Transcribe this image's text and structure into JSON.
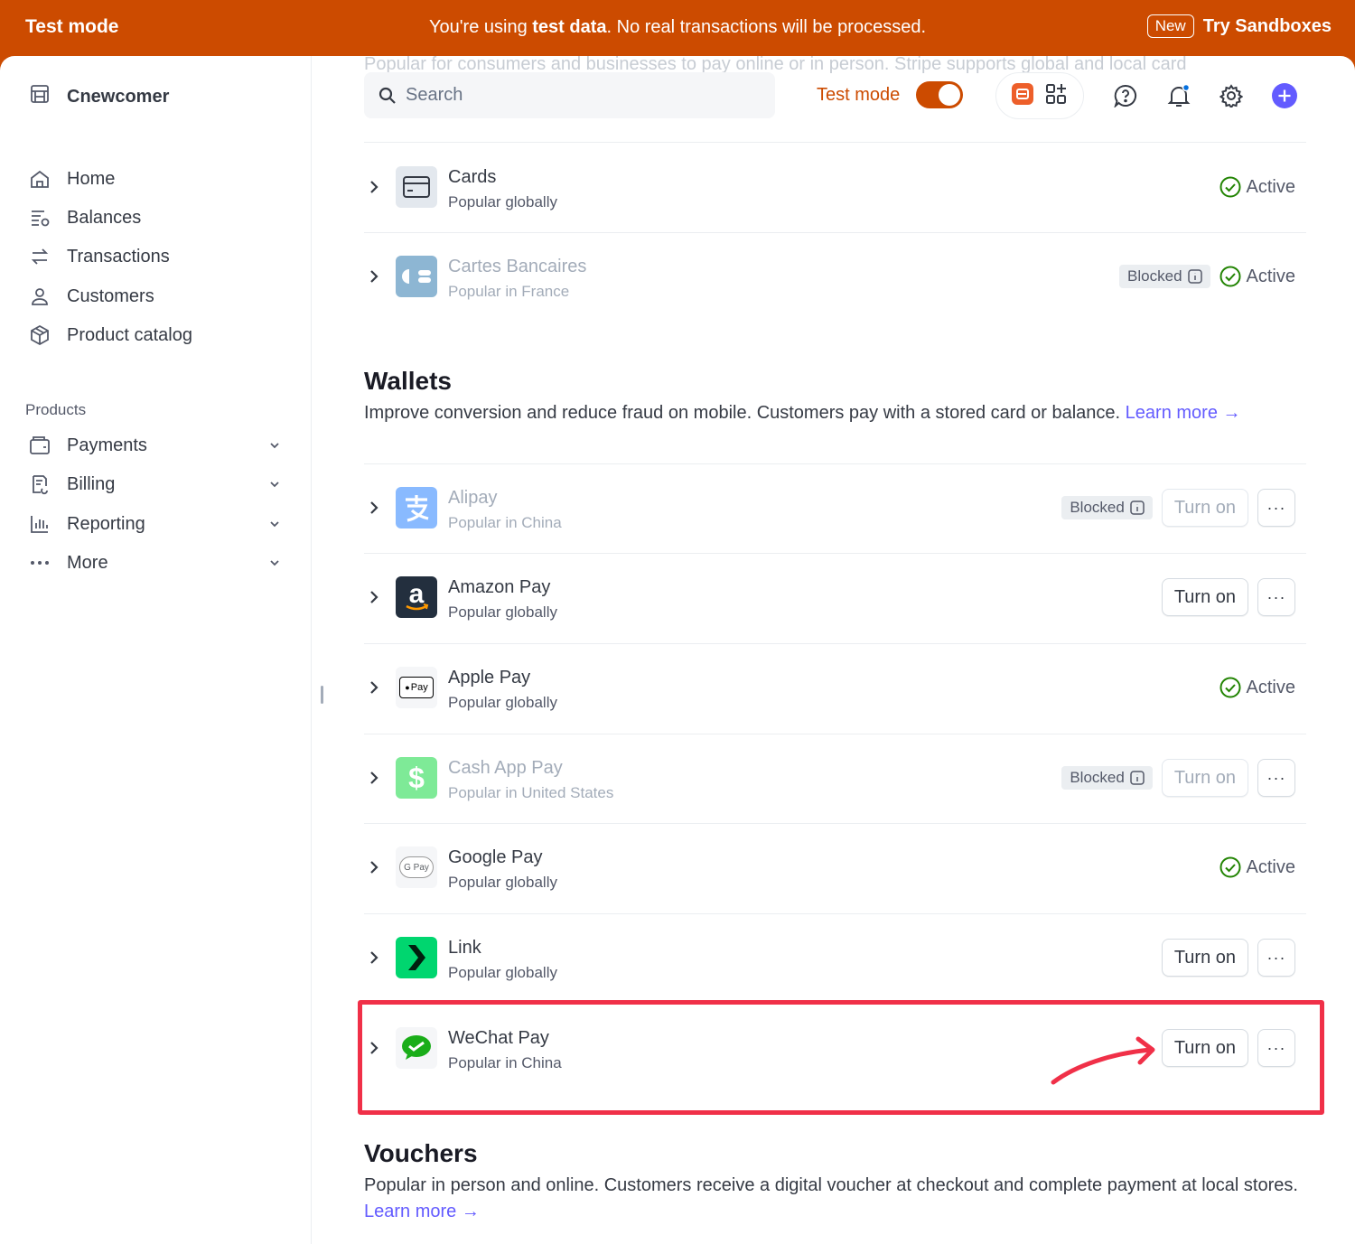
{
  "banner": {
    "label": "Test mode",
    "message_pre": "You're using ",
    "message_bold": "test data",
    "message_post": ". No real transactions will be processed.",
    "new_badge": "New",
    "sandboxes_link": "Try Sandboxes"
  },
  "sidebar": {
    "account": "Cnewcomer",
    "nav": [
      {
        "label": "Home",
        "icon": "home-icon"
      },
      {
        "label": "Balances",
        "icon": "balances-icon"
      },
      {
        "label": "Transactions",
        "icon": "transactions-icon"
      },
      {
        "label": "Customers",
        "icon": "customers-icon"
      },
      {
        "label": "Product catalog",
        "icon": "product-catalog-icon"
      }
    ],
    "products_label": "Products",
    "products": [
      {
        "label": "Payments",
        "icon": "payments-icon"
      },
      {
        "label": "Billing",
        "icon": "billing-icon"
      },
      {
        "label": "Reporting",
        "icon": "reporting-icon"
      },
      {
        "label": "More",
        "icon": "more-icon"
      }
    ]
  },
  "topbar": {
    "obscured_text": "Popular for consumers and businesses to pay online or in person. Stripe supports global and local card",
    "search_placeholder": "Search",
    "test_mode_label": "Test mode",
    "test_mode_on": true
  },
  "cards_section": {
    "rows": [
      {
        "name": "Cards",
        "sub": "Popular globally",
        "status": "Active"
      },
      {
        "name": "Cartes Bancaires",
        "sub": "Popular in France",
        "blocked": "Blocked",
        "status": "Active"
      }
    ]
  },
  "wallets": {
    "title": "Wallets",
    "description": "Improve conversion and reduce fraud on mobile. Customers pay with a stored card or balance.",
    "learn_more": "Learn more →",
    "rows": [
      {
        "name": "Alipay",
        "sub": "Popular in China",
        "blocked": "Blocked",
        "action": "Turn on"
      },
      {
        "name": "Amazon Pay",
        "sub": "Popular globally",
        "action": "Turn on"
      },
      {
        "name": "Apple Pay",
        "sub": "Popular globally",
        "status": "Active",
        "logo_text": "Pay"
      },
      {
        "name": "Cash App Pay",
        "sub": "Popular in United States",
        "blocked": "Blocked",
        "action": "Turn on"
      },
      {
        "name": "Google Pay",
        "sub": "Popular globally",
        "status": "Active",
        "logo_text": "G Pay"
      },
      {
        "name": "Link",
        "sub": "Popular globally",
        "action": "Turn on"
      },
      {
        "name": "WeChat Pay",
        "sub": "Popular in China",
        "action": "Turn on"
      }
    ]
  },
  "vouchers": {
    "title": "Vouchers",
    "description": "Popular in person and online. Customers receive a digital voucher at checkout and complete payment at local stores.",
    "learn_more": "Learn more →"
  },
  "colors": {
    "test_mode": "#cc4b00",
    "brand": "#635bff",
    "active": "#228403",
    "highlight": "#f03048"
  },
  "more_glyph": "···"
}
